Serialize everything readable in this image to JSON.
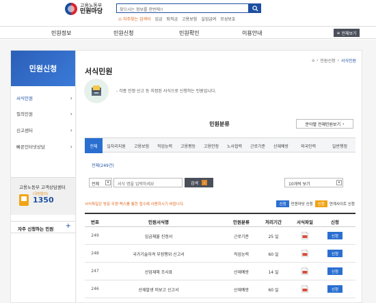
{
  "header": {
    "logo_line1": "고용노동부",
    "logo_line2": "민원마당",
    "search_placeholder": "찾으시는 정보를 한번에!!",
    "quick_hot": "자주찾는 검색어",
    "quick_links": [
      "임금",
      "퇴직금",
      "고용보험",
      "실업급여",
      "모성보호"
    ]
  },
  "nav": {
    "items": [
      "민원정보",
      "민원신청",
      "민원확인",
      "이용안내"
    ],
    "all_menu": "전체보기"
  },
  "sidebar": {
    "title": "민원신청",
    "items": [
      {
        "label": "서식민원",
        "active": true
      },
      {
        "label": "질의민원",
        "active": false
      },
      {
        "label": "신고센터",
        "active": false
      },
      {
        "label": "빠른인터넷상담",
        "active": false
      }
    ],
    "callcenter_title": "고용노동부 고객상담센터",
    "callcenter_sub": "(국번없이)",
    "callcenter_number": "1350",
    "frequent_label": "자주 신청하는 민원"
  },
  "main": {
    "breadcrumb": [
      "민원신청",
      "서식민원"
    ],
    "title": "서식민원",
    "description": "- 각종 진정·신고 등 지정된 서식으로 신청하는 민원입니다.",
    "section_title": "민원분류",
    "category_button": "분야별 전체민원보기",
    "tabs": [
      "전체",
      "일자리지원",
      "고용보험",
      "직업능력",
      "고용평등",
      "고용안정",
      "노사협력",
      "근로기준",
      "산재예방",
      "외국인력",
      "일반행정"
    ],
    "active_tab": 0,
    "subfilter": "전체(249건)",
    "select_value": "전체",
    "keyword_placeholder": "서식 명을 입력하세요",
    "search_button": "검색",
    "view_select": "10개씩 보기",
    "note": "서식파일은 방문·우편·팩스를 통한 접수에 사용하시기 바랍니다.",
    "legend": [
      {
        "box": "신청",
        "label": "민원마당 신청",
        "color": "#2a6fd0"
      },
      {
        "box": "신청",
        "label": "연계사이트 신청",
        "color": "#f0a316"
      }
    ],
    "table": {
      "headers": [
        "번호",
        "민원서식명",
        "민원분류",
        "처리기간",
        "서식파일",
        "신청"
      ],
      "rows": [
        {
          "no": "249",
          "name": "임금체불 진정서",
          "category": "근로기준",
          "period": "25 일",
          "apply": "신청"
        },
        {
          "no": "248",
          "name": "국가기술자격 부정행위 신고서",
          "category": "직업능력",
          "period": "60 일",
          "apply": "신청"
        },
        {
          "no": "247",
          "name": "산업재해 조사표",
          "category": "산재예방",
          "period": "14 일",
          "apply": "신청"
        },
        {
          "no": "246",
          "name": "산재발생 미보고 신고서",
          "category": "산재예방",
          "period": "60 일",
          "apply": "신청"
        }
      ]
    }
  },
  "colors": {
    "primary": "#1d4fa0",
    "tab_active": "#2a6fd0",
    "accent_orange": "#e0651a"
  }
}
